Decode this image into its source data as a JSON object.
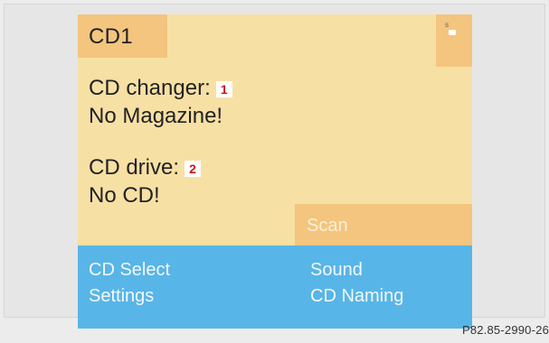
{
  "screen": {
    "title": "CD1",
    "corner_icon": "disc-status-icon",
    "corner_icon_text": "s",
    "changer_label": "CD changer:",
    "changer_marker": "1",
    "changer_status": "No Magazine!",
    "drive_label": "CD drive:",
    "drive_marker": "2",
    "drive_status": "No CD!",
    "scan_label": "Scan"
  },
  "menu": {
    "cd_select": "CD Select",
    "settings": "Settings",
    "sound": "Sound",
    "cd_naming": "CD Naming"
  },
  "figure": {
    "reference_code": "P82.85-2990-26"
  },
  "colors": {
    "screen_background": "#f7e0a4",
    "title_tab": "#f3c57e",
    "menu_bar": "#58b5e8",
    "marker_text": "#c41616",
    "outer_background": "#e6e6e6"
  }
}
